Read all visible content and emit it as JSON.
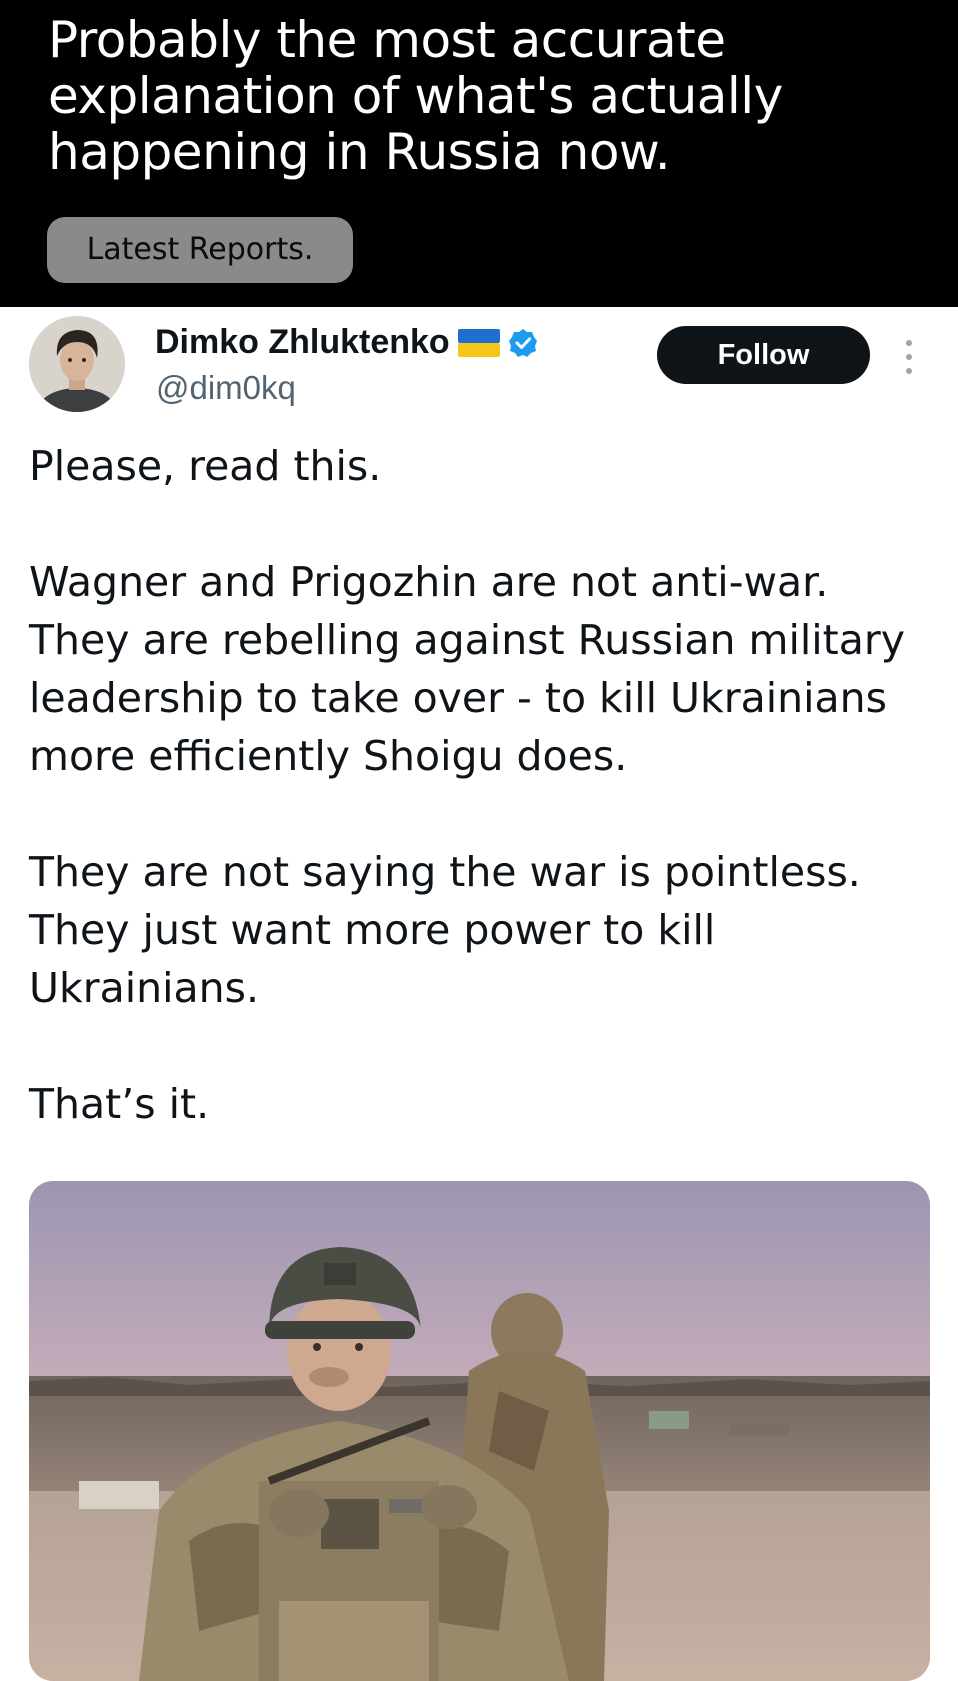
{
  "banner": {
    "headline": "Probably the most accurate explanation of what's actually happening in Russia now.",
    "pill_label": "Latest Reports."
  },
  "tweet": {
    "author_name": "Dimko Zhluktenko",
    "author_handle": "@dim0kq",
    "follow_label": "Follow",
    "flag_icon": "ukraine-flag-icon",
    "verified_icon": "verified-badge-icon",
    "more_icon": "more-vertical-icon",
    "paragraphs": [
      "Please, read this.",
      "Wagner and Prigozhin are not anti-war. They are rebelling against Russian military leadership to take over - to kill Ukrainians more efficiently Shoigu does.",
      "They are not saying the war is pointless. They just want more power to kill Ukrainians.",
      "That’s it."
    ]
  },
  "colors": {
    "verified": "#1d9bf0",
    "follow_bg": "#0f1419",
    "handle": "#536471"
  }
}
